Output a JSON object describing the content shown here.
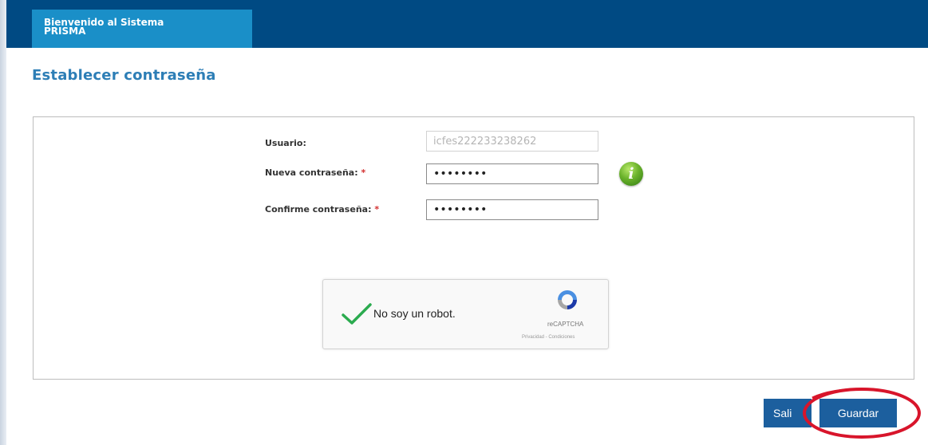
{
  "header": {
    "brand_line1": "Bienvenido al Sistema",
    "brand_line2": "PRISMA"
  },
  "page": {
    "title": "Establecer contraseña"
  },
  "form": {
    "user_label": "Usuario:",
    "user_value": "icfes222233238262",
    "new_password_label": "Nueva contraseña:",
    "new_password_value": "••••••••",
    "confirm_password_label": "Confirme contraseña:",
    "confirm_password_value": "••••••••",
    "required_marker": "*"
  },
  "captcha": {
    "label": "No soy un robot.",
    "brand": "reCAPTCHA",
    "terms": "Privacidad - Condiciones"
  },
  "actions": {
    "exit_label": "Sali",
    "save_label": "Guardar"
  },
  "colors": {
    "header_bg": "#004a83",
    "brand_tab_bg": "#1a8fc8",
    "title_color": "#2d7eb6",
    "button_bg": "#1c5f9e",
    "highlight_ring": "#d8152b",
    "check_green": "#2bab4f"
  },
  "icons": {
    "info": "info-icon",
    "check": "checkmark-icon",
    "recaptcha": "recaptcha-logo-icon"
  }
}
